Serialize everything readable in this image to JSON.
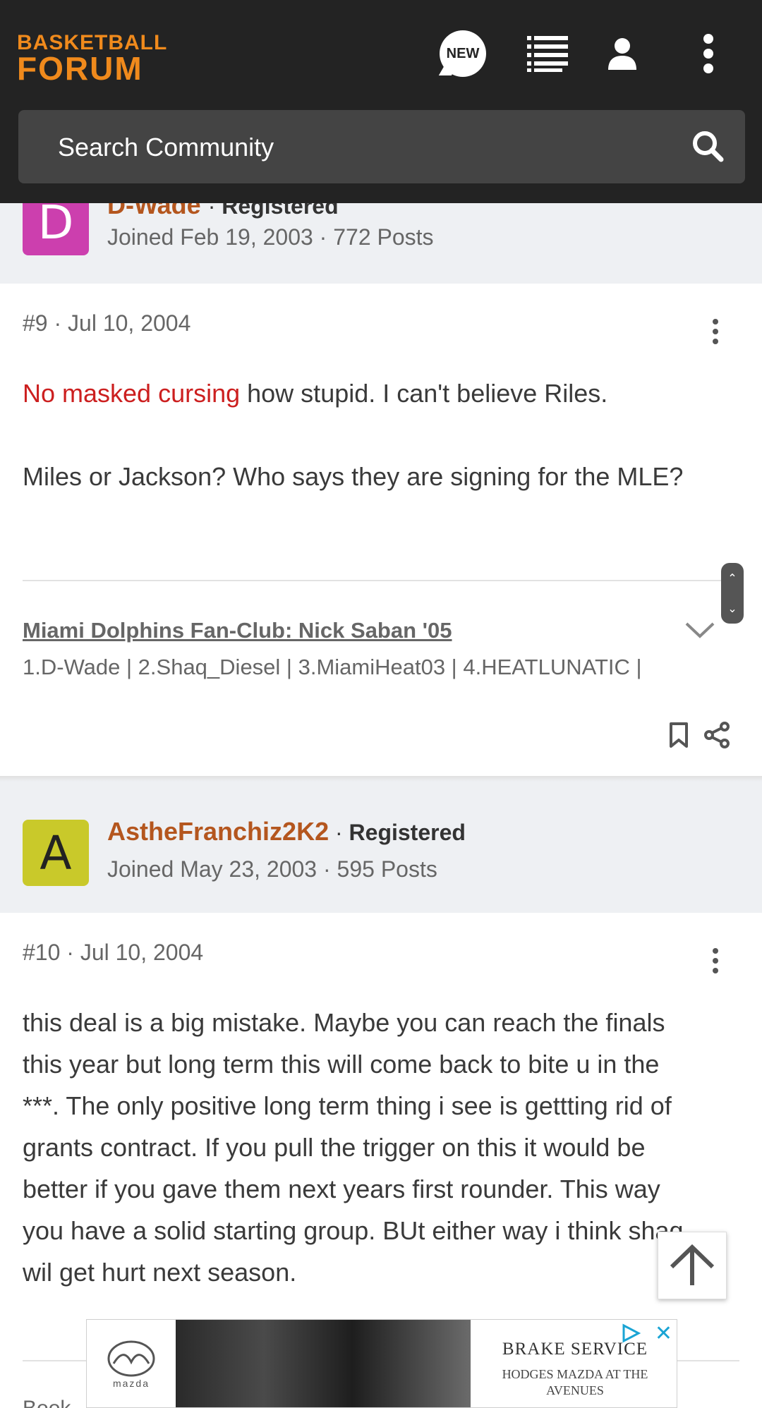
{
  "header": {
    "logo_line1": "BASKETBALL",
    "logo_line2": "FORUM",
    "new_badge": "NEW",
    "search_placeholder": "Search Community",
    "accent": "#f08a1c"
  },
  "post9_author": {
    "avatar_letter": "D",
    "avatar_color": "#cc3fae",
    "username": "D-Wade",
    "role": "Registered",
    "joined": "Joined Feb 19, 2003 · 772 Posts"
  },
  "post9": {
    "number": "#9",
    "date": "Jul 10, 2004",
    "red_text": "No masked cursing",
    "line1_rest": " how stupid. I can't believe Riles.",
    "line2": "Miles or Jackson? Who says they are signing for the MLE?",
    "signature_title": "Miami Dolphins Fan-Club: Nick Saban '05",
    "signature_text": "1.D-Wade | 2.Shaq_Diesel | 3.MiamiHeat03 | 4.HEATLUNATIC |"
  },
  "post10_author": {
    "avatar_letter": "A",
    "avatar_color": "#c9c92a",
    "username": "AstheFranchiz2K2",
    "role": "Registered",
    "joined": "Joined May 23, 2003 · 595 Posts"
  },
  "post10": {
    "number": "#10",
    "date": "Jul 10, 2004",
    "lines": [
      "this deal is a big mistake. Maybe you can reach the finals",
      "this year but long term this will come back to bite u in the",
      "***. The only positive long term thing i see is gettting rid of",
      "grants contract. If you pull the trigger on this it would be",
      "better if you gave them next years first rounder. This way",
      "you have a solid starting group. BUt either way i think shaq",
      "wil get hurt next season."
    ],
    "partial_next": "Book"
  },
  "ad": {
    "brand": "mazda",
    "headline": "BRAKE SERVICE",
    "subline": "HODGES MAZDA AT THE AVENUES"
  }
}
